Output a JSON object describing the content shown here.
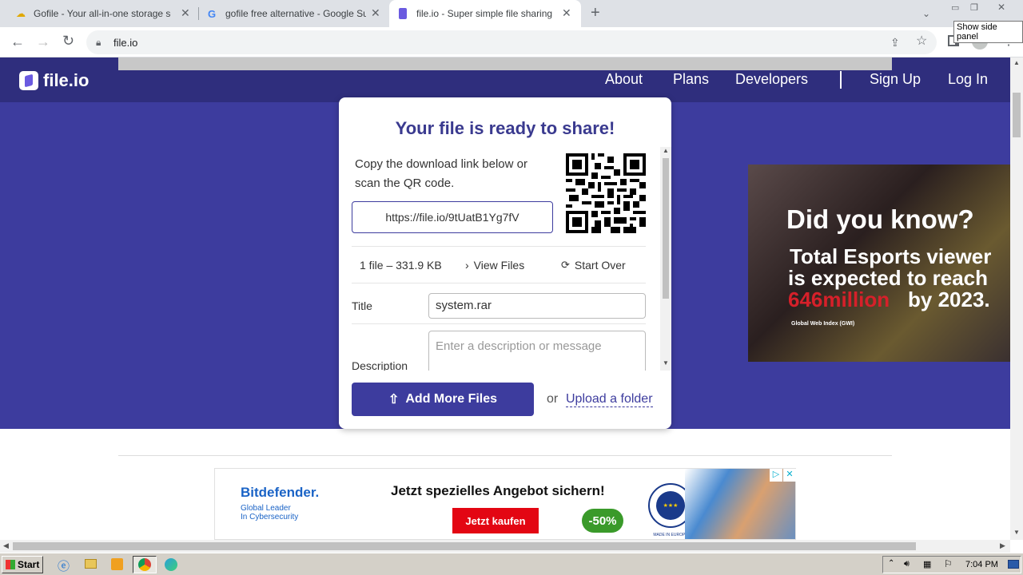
{
  "browser": {
    "tabs": [
      {
        "title": "Gofile - Your all-in-one storage soluti"
      },
      {
        "title": "gofile free alternative - Google Such"
      },
      {
        "title": "file.io - Super simple file sharing"
      }
    ],
    "url": "file.io",
    "tooltip": "Show side panel"
  },
  "nav": {
    "logo": "file.io",
    "links": [
      "About",
      "Plans",
      "Developers",
      "Sign Up",
      "Log In"
    ]
  },
  "card": {
    "title": "Your file is ready to share!",
    "instructions": "Copy the download link below or scan the QR code.",
    "link": "https://file.io/9tUatB1Yg7fV",
    "file_summary": "1 file – 331.9 KB",
    "view_files": "View Files",
    "start_over": "Start Over",
    "title_label": "Title",
    "title_value": "system.rar",
    "description_label": "Description",
    "description_placeholder": "Enter a description or message",
    "add_more": "Add More Files",
    "or": "or",
    "upload_folder": "Upload a folder"
  },
  "side_ad": {
    "line1": "Did you know?",
    "line2": "Total Esports viewer",
    "line3": "is expected to reach",
    "line4a": "646million",
    "line4b": "by 2023.",
    "source": "Global Web Index (GWI)"
  },
  "bottom_ad": {
    "brand": "Bitdefender.",
    "tagline1": "Global Leader",
    "tagline2": "In Cybersecurity",
    "headline": "Jetzt spezielles Angebot sichern!",
    "cta": "Jetzt kaufen",
    "discount": "-50%",
    "badge": "MADE IN EUROPE"
  },
  "taskbar": {
    "start": "Start",
    "time": "7:04 PM"
  },
  "colors": {
    "brand": "#3d3c9e",
    "nav": "#2f2e7d",
    "ad_red": "#e30613",
    "ad_green": "#3a9a2a"
  }
}
